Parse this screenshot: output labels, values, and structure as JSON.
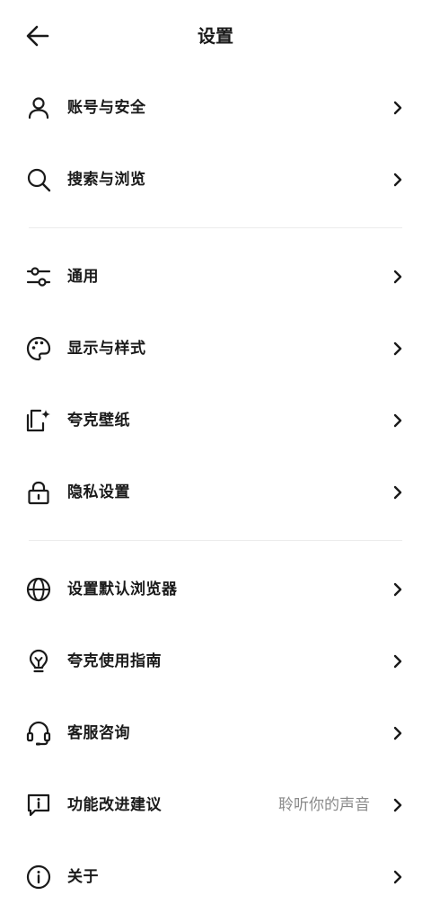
{
  "header": {
    "title": "设置",
    "back_icon": "arrow-left-icon"
  },
  "sections": [
    {
      "items": [
        {
          "label": "账号与安全",
          "icon": "user-icon"
        },
        {
          "label": "搜索与浏览",
          "icon": "search-icon"
        }
      ]
    },
    {
      "items": [
        {
          "label": "通用",
          "icon": "sliders-icon"
        },
        {
          "label": "显示与样式",
          "icon": "palette-icon"
        },
        {
          "label": "夸克壁纸",
          "icon": "wallpaper-icon"
        },
        {
          "label": "隐私设置",
          "icon": "lock-icon"
        }
      ]
    },
    {
      "items": [
        {
          "label": "设置默认浏览器",
          "icon": "globe-icon"
        },
        {
          "label": "夸克使用指南",
          "icon": "bulb-icon"
        },
        {
          "label": "客服咨询",
          "icon": "headset-icon"
        },
        {
          "label": "功能改进建议",
          "icon": "feedback-icon",
          "hint": "聆听你的声音"
        },
        {
          "label": "关于",
          "icon": "info-icon"
        }
      ]
    }
  ],
  "chevron_icon": "chevron-right-icon"
}
